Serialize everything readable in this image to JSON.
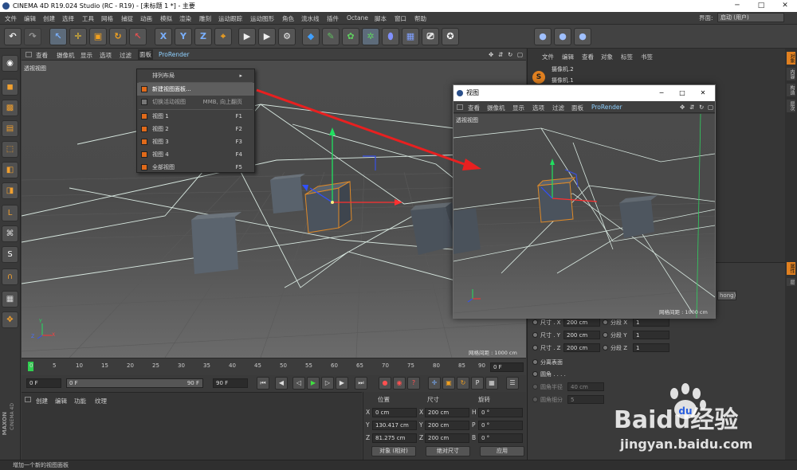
{
  "window": {
    "title": "CINEMA 4D R19.024 Studio (RC - R19) - [未标题 1 *] - 主要",
    "minimize": "─",
    "maximize": "□",
    "close": "✕"
  },
  "menubar": {
    "items": [
      "文件",
      "编辑",
      "创建",
      "选择",
      "工具",
      "网格",
      "捕捉",
      "动画",
      "模拟",
      "渲染",
      "雕刻",
      "运动跟踪",
      "运动图形",
      "角色",
      "流水线",
      "插件",
      "Octane",
      "脚本",
      "窗口",
      "帮助"
    ],
    "interface_label": "界面:",
    "interface_value": "启动 (用户)"
  },
  "toolbar": {
    "axis_x": "X",
    "axis_y": "Y",
    "axis_z": "Z"
  },
  "viewport": {
    "menu": [
      "查看",
      "摄像机",
      "显示",
      "选项",
      "过滤",
      "面板",
      "ProRender"
    ],
    "active_menu": "面板",
    "label": "透视视图",
    "grid_spacing": "网格间距 : 1000 cm",
    "axis_y": "Y",
    "axis_z": "Z",
    "axis_x": "X"
  },
  "panel_menu": {
    "items": [
      {
        "label": "排列布局",
        "shortcut": "▸"
      },
      {
        "label": "新建视图面板...",
        "shortcut": ""
      },
      {
        "label": "切换活动视图",
        "shortcut": "MMB, 向上翻页"
      },
      {
        "label": "视图 1",
        "shortcut": "F1"
      },
      {
        "label": "视图 2",
        "shortcut": "F2"
      },
      {
        "label": "视图 3",
        "shortcut": "F3"
      },
      {
        "label": "视图 4",
        "shortcut": "F4"
      },
      {
        "label": "全部视图",
        "shortcut": "F5"
      }
    ]
  },
  "timeline": {
    "ticks": [
      "0",
      "5",
      "10",
      "15",
      "20",
      "25",
      "30",
      "35",
      "40",
      "45",
      "50",
      "55",
      "60",
      "65",
      "70",
      "75",
      "80",
      "85",
      "90"
    ],
    "end_field": "0 F"
  },
  "playbar": {
    "start": "0 F",
    "current": "0 F",
    "end": "90 F",
    "max": "90 F"
  },
  "material": {
    "menu": [
      "创建",
      "编辑",
      "功能",
      "纹理"
    ]
  },
  "coords": {
    "headers": [
      "位置",
      "尺寸",
      "旋转"
    ],
    "rows": [
      {
        "a": "X",
        "pos": "0 cm",
        "b": "X",
        "size": "200 cm",
        "c": "H",
        "rot": "0 °"
      },
      {
        "a": "Y",
        "pos": "130.417 cm",
        "b": "Y",
        "size": "200 cm",
        "c": "P",
        "rot": "0 °"
      },
      {
        "a": "Z",
        "pos": "81.275 cm",
        "b": "Z",
        "size": "200 cm",
        "c": "B",
        "rot": "0 °"
      }
    ],
    "mode": "对象 (相对)",
    "size_mode": "绝对尺寸",
    "apply": "应用"
  },
  "status": {
    "text": "增加一个新的视图面板"
  },
  "object_manager": {
    "menu": [
      "文件",
      "编辑",
      "查看",
      "对象",
      "标签",
      "书签"
    ],
    "rows": [
      "摄像机.2",
      "摄像机.1"
    ]
  },
  "attributes": {
    "phong": "hong)",
    "rows": [
      {
        "l": "尺寸 . X",
        "v": "200 cm",
        "s": "分段 X",
        "sv": "1"
      },
      {
        "l": "尺寸 . Y",
        "v": "200 cm",
        "s": "分段 Y",
        "sv": "1"
      },
      {
        "l": "尺寸 . Z",
        "v": "200 cm",
        "s": "分段 Z",
        "sv": "1"
      }
    ],
    "sep": "分离表面",
    "fillet": "圆角 . . . .",
    "fillet_r": "圆角半径",
    "fillet_r_v": "40 cm",
    "fillet_s": "圆角细分",
    "fillet_s_v": "5"
  },
  "right_tabs": [
    "对象",
    "内容",
    "构造",
    "层次",
    "属性",
    "层"
  ],
  "float_window": {
    "title": "视图",
    "menu": [
      "查看",
      "摄像机",
      "显示",
      "选项",
      "过滤",
      "面板",
      "ProRender"
    ],
    "label": "透视视图",
    "grid_spacing": "网格间距 : 1000 cm",
    "minimize": "─",
    "maximize": "□",
    "close": "✕"
  },
  "brand": {
    "maxon": "MAXON",
    "cinema": "CINEMA 4D"
  },
  "watermark": {
    "text": "Baidu经验",
    "url": "jingyan.baidu.com"
  },
  "colors": {
    "accent": "#e08020",
    "arrow": "#e82020",
    "wire": "#d8e8e0"
  }
}
